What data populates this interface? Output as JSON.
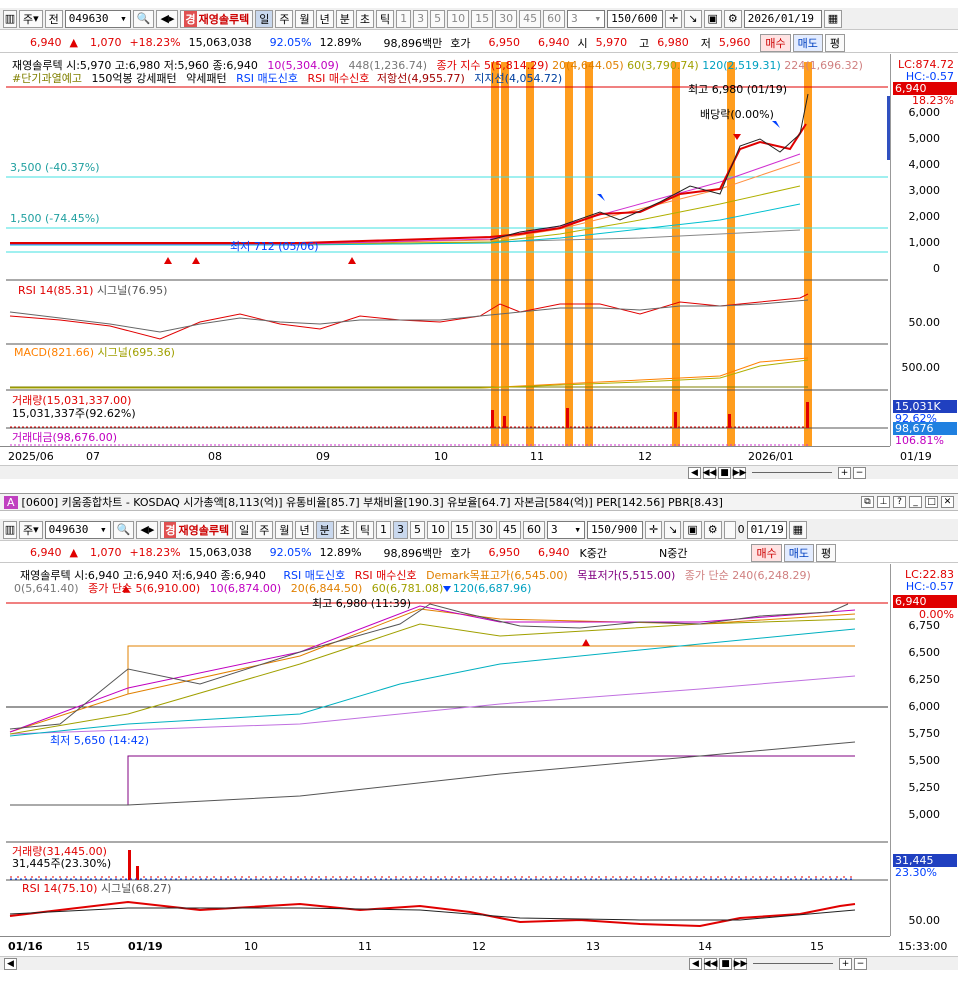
{
  "colors": {
    "up": "#e00000",
    "down": "#0040ff",
    "accent": "#ff9d1e",
    "cyan": "#40e0e0"
  },
  "top": {
    "toolbar": {
      "market": "주",
      "prev": "전",
      "code": "049630",
      "name": "재영솔루텍",
      "periods": [
        "일",
        "주",
        "월",
        "년",
        "분",
        "초",
        "틱"
      ],
      "selected_period": "일",
      "nums": [
        "1",
        "3",
        "5",
        "10",
        "15",
        "30",
        "45",
        "60"
      ],
      "count_sel": "3",
      "count": "150/600",
      "date": "2026/01/19",
      "search_icon": "search-icon",
      "sound_icon": "speaker-icon",
      "grid_icon": "crosshair-icon",
      "save_icon": "save-icon",
      "settings_icon": "gear-icon"
    },
    "info": {
      "price": "6,940",
      "change": "1,070",
      "pct": "+18.23%",
      "volume": "15,063,038",
      "ratio": "92.05%",
      "turnover": "12.89%",
      "amount": "98,896백만",
      "quote_label": "호가",
      "ask": "6,950",
      "bid": "6,940",
      "open_label": "시",
      "open": "5,970",
      "high_label": "고",
      "high": "6,980",
      "low_label": "저",
      "low": "5,960",
      "buy": "매수",
      "sell": "매도",
      "flat": "평"
    },
    "legend1": "재영솔루텍 시:5,970 고:6,980 저:5,960 종:6,940",
    "legend2": "10(5,304.09)",
    "legend3": "448(1,236.74)",
    "legend4": "종가 지수 5(5,814.29)",
    "legend5": "20(4,644.05)",
    "legend6": "60(3,790.74)",
    "legend7": "120(2,519.31)",
    "legend8": "224(1,696.32)",
    "legend9": "#단기과열예고",
    "legend10": "150억봉 강세패턴",
    "legend11": "약세패턴",
    "legend12": "RSI 매도신호",
    "legend13": "RSI 매수신호",
    "legend14": "저항선(4,955.77)",
    "legend15": "지지선(4,054.72)",
    "lc": "LC:874.72",
    "hc": "HC:-0.57",
    "last_price": "6,940",
    "last_pct": "18.23%",
    "yticks": [
      "6,000",
      "5,000",
      "4,000",
      "3,000",
      "2,000",
      "1,000",
      "0"
    ],
    "max_label": "최고 6,980 (01/19)",
    "min_label": "최저 712 (05/06)",
    "div_label": "배당락(0.00%)",
    "level1": "3,500 (-40.37%)",
    "level2": "1,500 (-74.45%)",
    "rsi": "RSI 14(85.31)",
    "rsi_sig": "시그널(76.95)",
    "rsi_tick": "50.00",
    "macd": "MACD(821.66)",
    "macd_sig": "시그널(695.36)",
    "macd_tick": "500.00",
    "vol": "거래량(15,031,337.00)",
    "vol2": "15,031,337주(92.62%)",
    "vol_box": "15,031K",
    "vol_box2": "92.62%",
    "amt": "거래대금(98,676.00)",
    "amt_box": "98,676",
    "amt_box2": "106.81%",
    "xlabels": [
      "2025/06",
      "07",
      "08",
      "09",
      "10",
      "11",
      "12",
      "2026/01",
      "01/19"
    ]
  },
  "bottom": {
    "title": "[0600] 키움종합차트 - KOSDAQ 시가총액[8,113(억)] 유통비율[85.7] 부채비율[190.3] 유보율[64.7] 자본금[584(억)] PER[142.56] PBR[8.43]",
    "toolbar": {
      "market": "주",
      "code": "049630",
      "name": "재영솔루텍",
      "periods": [
        "일",
        "주",
        "월",
        "년",
        "분",
        "초",
        "틱"
      ],
      "selected_period": "분",
      "nums": [
        "1",
        "3",
        "5",
        "10",
        "15",
        "30",
        "45",
        "60"
      ],
      "selected_num": "3",
      "count_sel": "3",
      "count": "150/900",
      "date_prefix": "0",
      "date": "01/19"
    },
    "info": {
      "price": "6,940",
      "change": "1,070",
      "pct": "+18.23%",
      "volume": "15,063,038",
      "ratio": "92.05%",
      "turnover": "12.89%",
      "amount": "98,896백만",
      "quote_label": "호가",
      "ask": "6,950",
      "bid": "6,940",
      "k_label": "K중간",
      "n_label": "N중간",
      "buy": "매수",
      "sell": "매도",
      "flat": "평"
    },
    "legend1": "재영솔루텍 시:6,940 고:6,940 저:6,940 종:6,940",
    "legend2": "RSI 매도신호",
    "legend3": "RSI 매수신호",
    "legend4": "Demark목표고가(6,545.00)",
    "legend5": "목표저가(5,515.00)",
    "legend6": "종가 단순 240(6,248.29)",
    "legend7": "0(5,641.40)",
    "legend8": "종가 단순 5(6,910.00)",
    "legend9": "10(6,874.00)",
    "legend10": "20(6,844.50)",
    "legend11": "60(6,781.08)",
    "legend12": "120(6,687.96)",
    "lc": "LC:22.83",
    "hc": "HC:-0.57",
    "last_price": "6,940",
    "last_pct": "0.00%",
    "yticks": [
      "6,750",
      "6,500",
      "6,250",
      "6,000",
      "5,750",
      "5,500",
      "5,250",
      "5,000"
    ],
    "max_label": "최고 6,980 (11:39)",
    "min_label": "최저 5,650 (14:42)",
    "vol": "거래량(31,445.00)",
    "vol2": "31,445주(23.30%)",
    "vol_box": "31,445",
    "vol_box2": "23.30%",
    "rsi": "RSI 14(75.10)",
    "rsi_sig": "시그널(68.27)",
    "rsi_tick": "50.00",
    "xlabels": [
      "01/16",
      "15",
      "01/19",
      "10",
      "11",
      "12",
      "13",
      "14",
      "15",
      "15:33:00"
    ]
  }
}
